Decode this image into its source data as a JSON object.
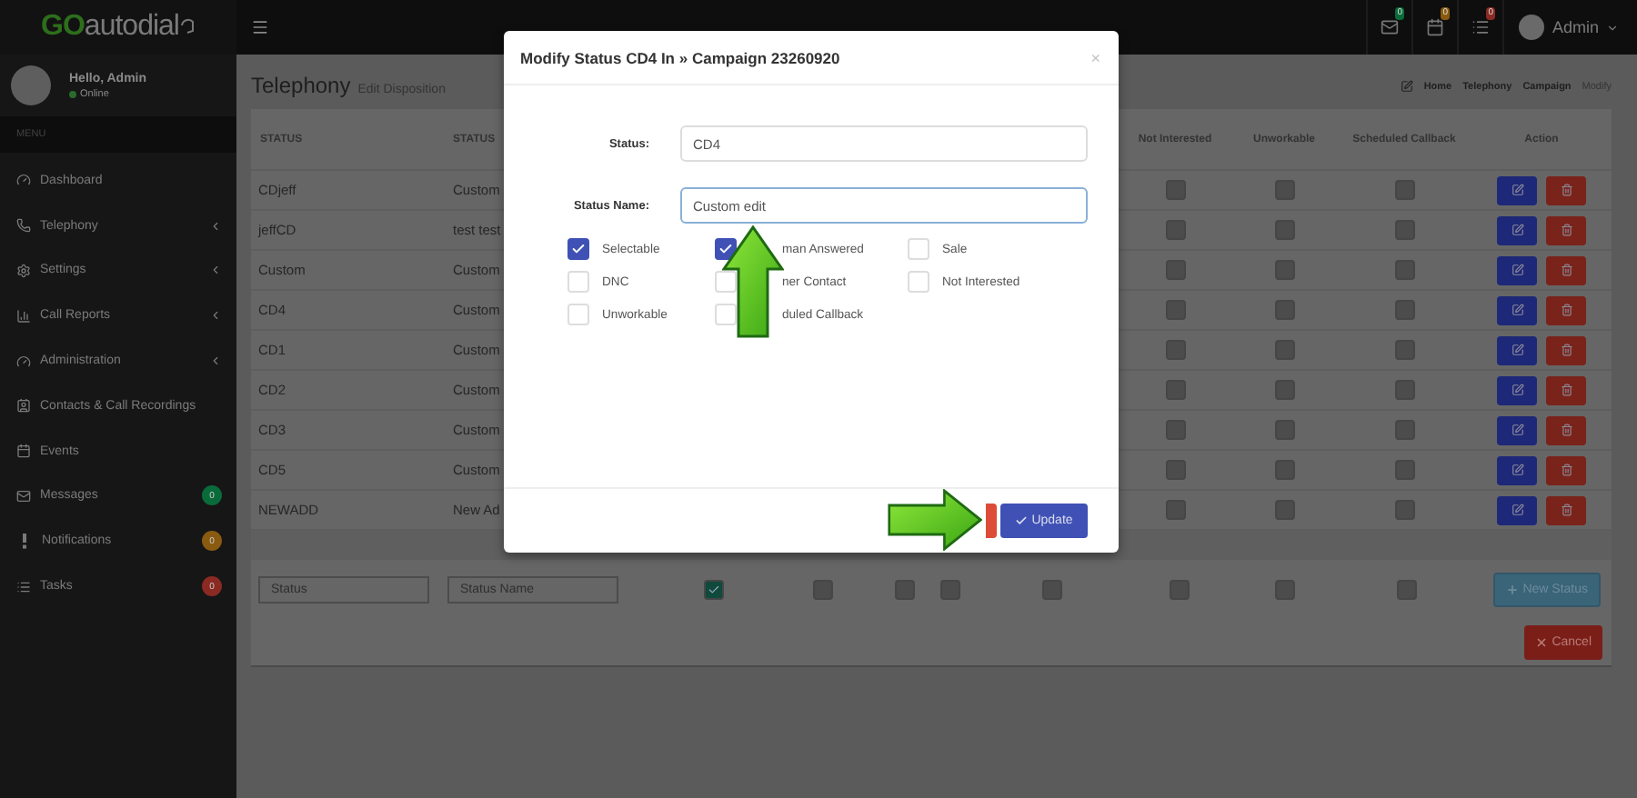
{
  "top_bar": {
    "logo_prefix": "GO",
    "logo_rest": "autodial",
    "alerts": [
      {
        "badge": "0",
        "color": "#0a6b3a"
      },
      {
        "badge": "0",
        "color": "#8a5a10"
      },
      {
        "badge": "0",
        "color": "#8a2a22"
      }
    ],
    "user": "Admin"
  },
  "sidebar": {
    "greeting": "Hello, Admin",
    "status": "Online",
    "menu_header": "MENU",
    "items": [
      {
        "label": "Dashboard",
        "expandable": false
      },
      {
        "label": "Telephony",
        "expandable": true
      },
      {
        "label": "Settings",
        "expandable": true
      },
      {
        "label": "Call Reports",
        "expandable": true
      },
      {
        "label": "Administration",
        "expandable": true
      },
      {
        "label": "Contacts & Call Recordings",
        "expandable": false
      },
      {
        "label": "Events",
        "expandable": false
      },
      {
        "label": "Messages",
        "expandable": false,
        "badge": "0",
        "color": "#0a6b3a"
      },
      {
        "label": "Notifications",
        "expandable": false,
        "badge": "0",
        "color": "#8a5a10"
      },
      {
        "label": "Tasks",
        "expandable": false,
        "badge": "0",
        "color": "#8a2a22"
      }
    ]
  },
  "page": {
    "title": "Telephony",
    "subtitle": "Edit Disposition",
    "breadcrumbs": [
      {
        "label": "Home",
        "selected": false
      },
      {
        "label": "Telephony",
        "selected": false
      },
      {
        "label": "Campaign",
        "selected": false
      },
      {
        "label": "Modify",
        "selected": true
      }
    ]
  },
  "table": {
    "columns": [
      "STATUS",
      "STATUS",
      "Not Interested",
      "Unworkable",
      "Scheduled Callback",
      "Action"
    ],
    "rows": [
      {
        "status": "CDjeff",
        "status_name": "Custom",
        "not_interested": false,
        "unworkable": false,
        "scheduled_callback": false
      },
      {
        "status": "jeffCD",
        "status_name": "test test",
        "not_interested": false,
        "unworkable": false,
        "scheduled_callback": false
      },
      {
        "status": "Custom",
        "status_name": "Custom",
        "not_interested": false,
        "unworkable": false,
        "scheduled_callback": false
      },
      {
        "status": "CD4",
        "status_name": "Custom",
        "not_interested": false,
        "unworkable": false,
        "scheduled_callback": false
      },
      {
        "status": "CD1",
        "status_name": "Custom",
        "not_interested": false,
        "unworkable": false,
        "scheduled_callback": false
      },
      {
        "status": "CD2",
        "status_name": "Custom",
        "not_interested": false,
        "unworkable": false,
        "scheduled_callback": false
      },
      {
        "status": "CD3",
        "status_name": "Custom",
        "not_interested": false,
        "unworkable": false,
        "scheduled_callback": false
      },
      {
        "status": "CD5",
        "status_name": "Custom",
        "not_interested": false,
        "unworkable": false,
        "scheduled_callback": false
      },
      {
        "status": "NEWADD",
        "status_name": "New Ad",
        "not_interested": false,
        "unworkable": false,
        "scheduled_callback": false
      }
    ]
  },
  "new_row": {
    "status_placeholder": "Status",
    "name_placeholder": "Status Name",
    "flags": [
      true,
      false,
      false,
      false,
      false,
      false,
      false,
      false
    ],
    "add_button": "New Status",
    "cancel_button": "Cancel"
  },
  "modal": {
    "title": "Modify Status CD4 In » Campaign 23260920",
    "close": "×",
    "status_label": "Status:",
    "status_value": "CD4",
    "name_label": "Status Name:",
    "name_value": "Custom edit",
    "options": [
      {
        "label": "Selectable",
        "checked": true
      },
      {
        "label": "man Answered",
        "checked": true
      },
      {
        "label": "Sale",
        "checked": false
      },
      {
        "label": "DNC",
        "checked": false
      },
      {
        "label": "ner Contact",
        "checked": false
      },
      {
        "label": "Not Interested",
        "checked": false
      },
      {
        "label": "Unworkable",
        "checked": false
      },
      {
        "label": "duled Callback",
        "checked": false
      }
    ],
    "buttons": [
      {
        "kind": "cancel"
      },
      {
        "kind": "update",
        "label": "Update"
      }
    ]
  },
  "annotations": [
    {
      "kind": "arrow-up"
    },
    {
      "kind": "arrow-right"
    }
  ]
}
